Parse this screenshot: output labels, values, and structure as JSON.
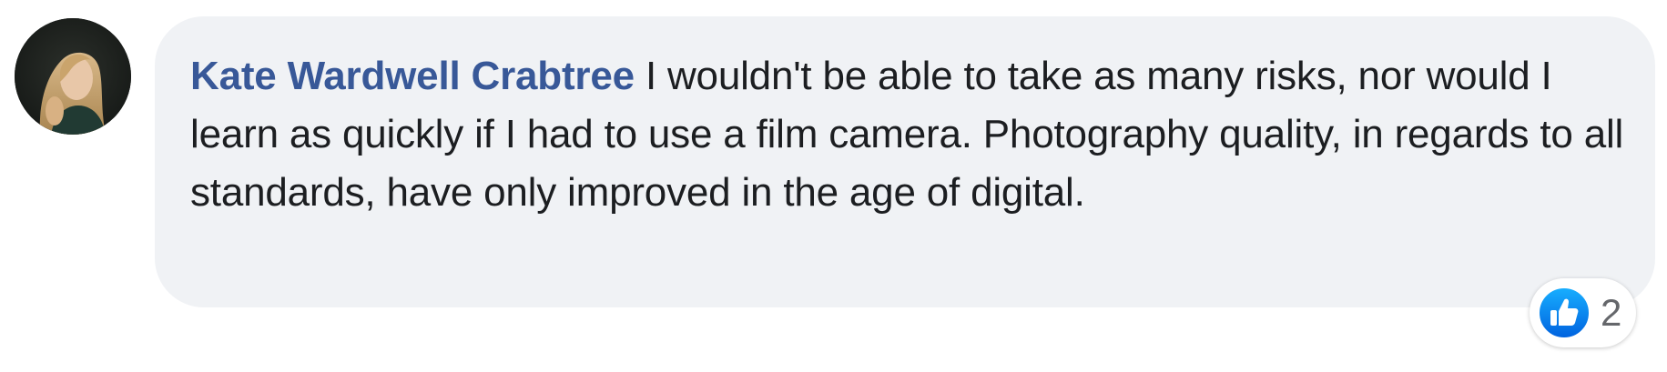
{
  "comment": {
    "author": "Kate Wardwell Crabtree",
    "text": "I wouldn't be able to take as many risks, nor would I learn as quickly if I had to use a film camera. Photography quality, in regards to all standards, have only improved in the age of digital."
  },
  "reactions": {
    "icon": "like-icon",
    "count": "2"
  },
  "colors": {
    "author_link": "#385898",
    "bubble_background": "#f0f2f5",
    "like_blue": "#1877f2"
  }
}
